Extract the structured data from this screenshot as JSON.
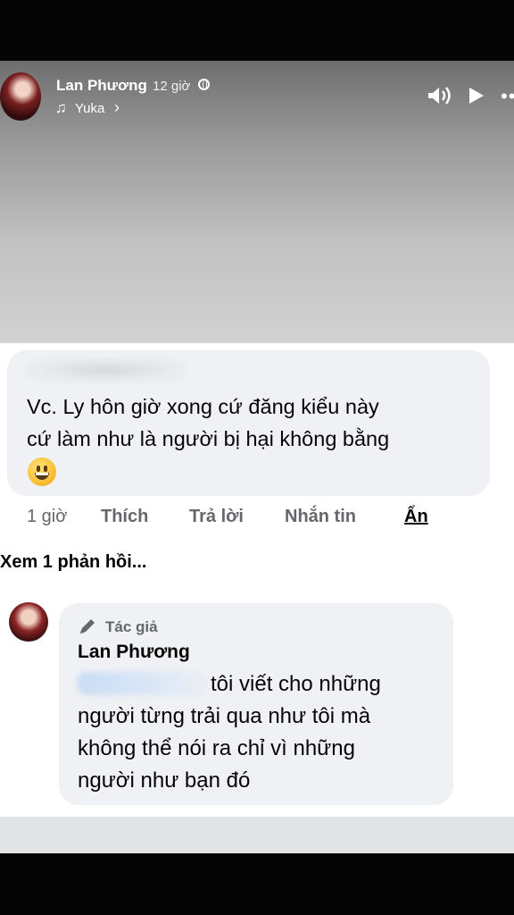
{
  "story": {
    "author": "Lan Phương",
    "time": "12 giờ",
    "music": "Yuka"
  },
  "comment": {
    "lines": [
      "Vc. Ly hôn giờ xong cứ đăng kiểu này",
      "cứ làm như là người bị hại không bằng"
    ],
    "time": "1 giờ",
    "like_label": "Thích",
    "reply_label": "Trả lời",
    "message_label": "Nhắn tin",
    "hide_label": "Ẩn"
  },
  "view_replies": "Xem 1 phản hồi...",
  "reply": {
    "badge": "Tác giả",
    "author": "Lan Phương",
    "lines": [
      "tôi viết cho những",
      "người từng trải qua như tôi mà",
      "không thể nói ra chỉ vì những",
      "người như bạn đó"
    ]
  },
  "icons": [
    "globe-icon",
    "music-icon",
    "chevron-right-icon",
    "volume-icon",
    "play-icon",
    "more-icon",
    "grin-emoji-icon",
    "pen-icon"
  ]
}
